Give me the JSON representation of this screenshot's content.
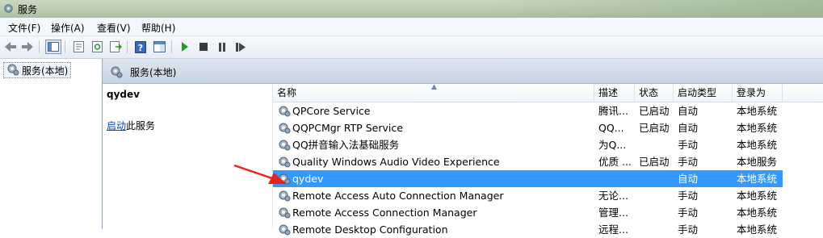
{
  "window": {
    "title": "服务"
  },
  "menu": [
    "文件(F)",
    "操作(A)",
    "查看(V)",
    "帮助(H)"
  ],
  "toolbar": {
    "icons": [
      "back-icon",
      "forward-icon",
      "console-tree-icon",
      "properties-icon",
      "refresh-icon",
      "export-list-icon",
      "help-icon",
      "show-hide-icon",
      "start-service-icon",
      "stop-service-icon",
      "pause-service-icon",
      "restart-service-icon"
    ]
  },
  "tree": {
    "root": "服务(本地)"
  },
  "pane": {
    "header": "服务(本地)"
  },
  "detail": {
    "service_name": "qydev",
    "start_link": "启动",
    "start_suffix": "此服务"
  },
  "columns": {
    "name": "名称",
    "description": "描述",
    "status": "状态",
    "startup": "启动类型",
    "logon": "登录为"
  },
  "services": [
    {
      "name": "QPCore Service",
      "description": "腾讯...",
      "status": "已启动",
      "startup": "自动",
      "logon": "本地系统"
    },
    {
      "name": "QQPCMgr RTP Service",
      "description": "QQ...",
      "status": "已启动",
      "startup": "自动",
      "logon": "本地系统"
    },
    {
      "name": "QQ拼音输入法基础服务",
      "description": "为Q...",
      "status": "",
      "startup": "手动",
      "logon": "本地系统"
    },
    {
      "name": "Quality Windows Audio Video Experience",
      "description": "优质 ...",
      "status": "已启动",
      "startup": "手动",
      "logon": "本地服务"
    },
    {
      "name": "qydev",
      "description": "",
      "status": "",
      "startup": "自动",
      "logon": "本地系统",
      "selected": true
    },
    {
      "name": "Remote Access Auto Connection Manager",
      "description": "无论...",
      "status": "",
      "startup": "手动",
      "logon": "本地系统"
    },
    {
      "name": "Remote Access Connection Manager",
      "description": "管理...",
      "status": "",
      "startup": "手动",
      "logon": "本地系统"
    },
    {
      "name": "Remote Desktop Configuration",
      "description": "远程...",
      "status": "",
      "startup": "手动",
      "logon": "本地系统"
    }
  ],
  "colors": {
    "selection": "#3399ff",
    "link": "#0645ad",
    "annotation_arrow": "#e8231b"
  }
}
